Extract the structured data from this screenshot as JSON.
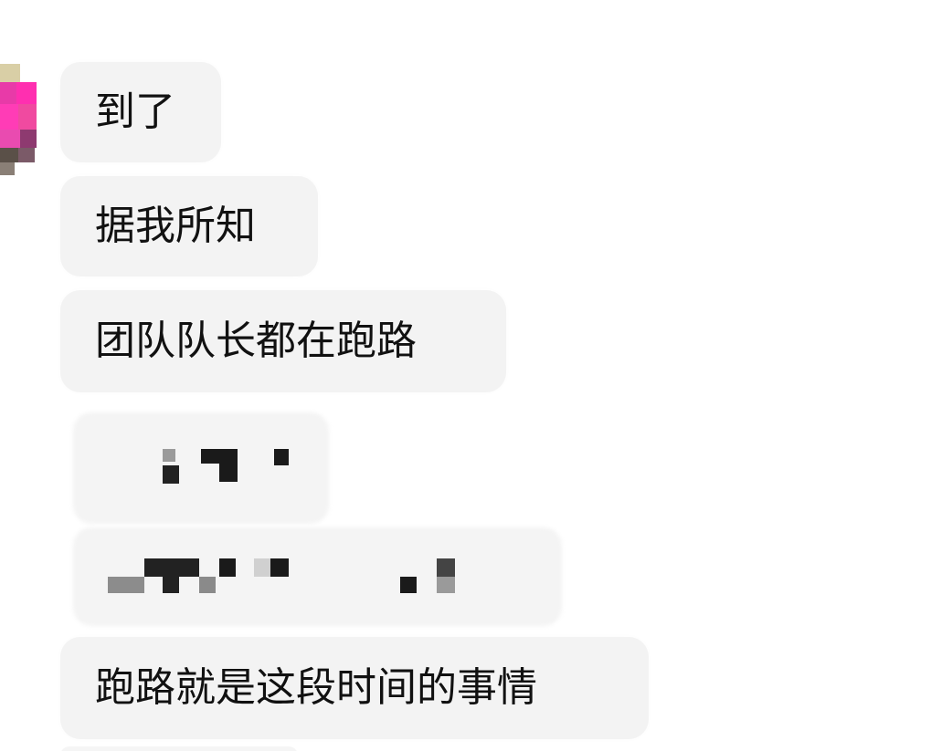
{
  "chat": {
    "messages": [
      {
        "text": "到了"
      },
      {
        "text": "据我所知"
      },
      {
        "text": "团队队长都在跑路"
      },
      {
        "text": "跑路就是这段时间的事情"
      }
    ],
    "redacted_messages": 2
  },
  "colors": {
    "bubble_bg": "#f3f3f3",
    "text": "#111111",
    "avatar_accent": "#ff2fb0"
  },
  "icons": {
    "avatar": "pixelated-avatar-icon"
  }
}
